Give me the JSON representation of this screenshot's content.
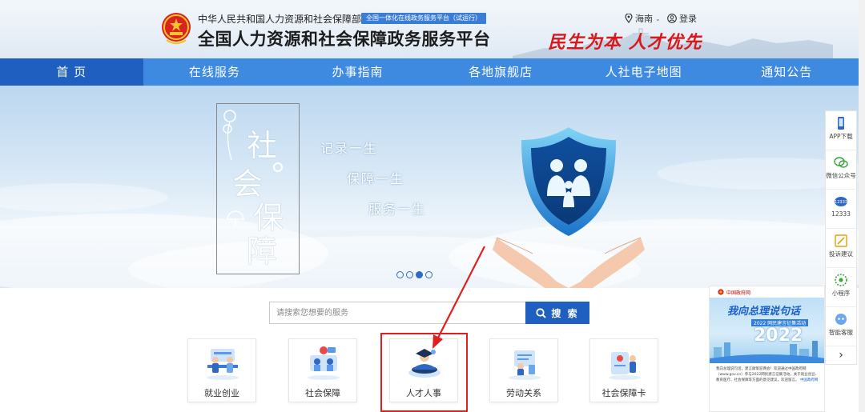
{
  "header": {
    "gov_name": "中华人民共和国人力资源和社会保障部",
    "badge": "全国一体化在线政务服务平台（试运行）",
    "site_title": "全国人力资源和社会保障政务服务平台",
    "slogan": "民生为本  人才优先",
    "region": "海南",
    "login": "登录"
  },
  "nav": {
    "items": [
      "首 页",
      "在线服务",
      "办事指南",
      "各地旗舰店",
      "人社电子地图",
      "通知公告"
    ],
    "active_index": 0
  },
  "banner": {
    "chars": [
      "社",
      "会",
      "保",
      "障"
    ],
    "lines": [
      "记录一生",
      "保障一生",
      "服务一生"
    ],
    "slide_count": 4,
    "active_slide": 2
  },
  "search": {
    "placeholder": "请搜索您想要的服务",
    "button": "搜 索"
  },
  "services": [
    {
      "label": "就业创业",
      "icon": "employment-icon"
    },
    {
      "label": "社会保障",
      "icon": "social-security-icon"
    },
    {
      "label": "人才人事",
      "icon": "talent-icon"
    },
    {
      "label": "劳动关系",
      "icon": "labor-relations-icon"
    },
    {
      "label": "社会保障卡",
      "icon": "security-card-icon"
    }
  ],
  "highlighted_service": "人才人事",
  "side_toolbar": {
    "items": [
      {
        "label": "APP下载",
        "icon": "phone-icon"
      },
      {
        "label": "微信公众号",
        "icon": "wechat-icon"
      },
      {
        "label": "12333",
        "icon": "hotline-icon"
      },
      {
        "label": "投诉建议",
        "icon": "edit-icon"
      },
      {
        "label": "小程序",
        "icon": "miniprogram-icon"
      },
      {
        "label": "智能客服",
        "icon": "robot-icon"
      }
    ],
    "collapse": "›"
  },
  "popup": {
    "source": "中国政府网",
    "headline": "我向总理说句话",
    "sub": "2022 网民建言征集活动",
    "year": "2022",
    "text": "我向总理说句话，建言献策迎两会！欢迎通过中国政府网（www.gov.cn）参与2022网民建言征集活动，关于就业创业、教育医疗、社会保障等方面的意见建议，欢迎留言。",
    "link": "中国政府网"
  },
  "colors": {
    "nav": "#3d8ae0",
    "nav_active": "#1f5fbf",
    "slogan": "#d8191c",
    "highlight": "#e02020"
  }
}
